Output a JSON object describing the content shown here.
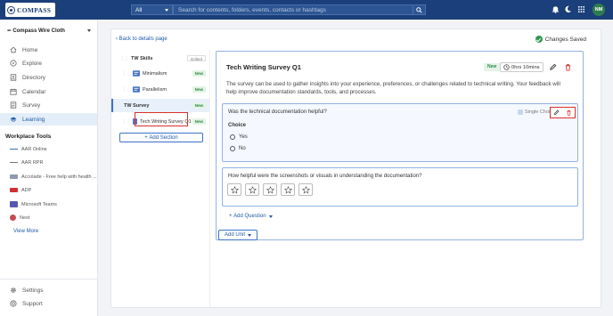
{
  "topbar": {
    "logo_text": "COMPASS",
    "scope_value": "All",
    "search_placeholder": "Search for contents, folders, events, contacts or hashtags",
    "avatar_initials": "NM",
    "bar_color": "#1b3f7a"
  },
  "sidebar": {
    "org_name": "Compass Wire Cloth",
    "nav": [
      {
        "label": "Home",
        "icon": "home-icon"
      },
      {
        "label": "Explore",
        "icon": "compass-icon"
      },
      {
        "label": "Directory",
        "icon": "directory-icon"
      },
      {
        "label": "Calendar",
        "icon": "calendar-icon"
      },
      {
        "label": "Survey",
        "icon": "survey-icon"
      },
      {
        "label": "Learning",
        "icon": "graduation-cap-icon",
        "active": true
      }
    ],
    "tools_heading": "Workplace Tools",
    "tools": [
      {
        "label": "AAR Online",
        "icon": "aar-icon"
      },
      {
        "label": "AAR RPR",
        "icon": "aar-icon"
      },
      {
        "label": "Accolade - Free help with health ...",
        "icon": "accolade-icon"
      },
      {
        "label": "ADP",
        "icon": "adp-icon"
      },
      {
        "label": "Microsoft Teams",
        "icon": "teams-icon"
      },
      {
        "label": "Next",
        "icon": "next-icon"
      }
    ],
    "view_more": "View More",
    "footer": [
      {
        "label": "Settings",
        "icon": "gear-icon"
      },
      {
        "label": "Support",
        "icon": "help-icon"
      }
    ]
  },
  "main": {
    "back_link": "Back to details page",
    "saved_status": "Changes Saved",
    "tree": {
      "items": [
        {
          "label": "TW Skills",
          "badge": "Edited",
          "kind": "section"
        },
        {
          "label": "Minimalism",
          "badge": "New",
          "kind": "unit"
        },
        {
          "label": "Parallelism",
          "badge": "New",
          "kind": "unit"
        },
        {
          "label": "TW Survey",
          "badge": "New",
          "kind": "section"
        },
        {
          "label": "Tech Writing Survey Q1",
          "badge": "New",
          "kind": "survey"
        }
      ],
      "add_section": "Add Section"
    },
    "survey": {
      "title": "Tech Writing Survey Q1",
      "badge": "New",
      "duration": "0hrs 10mins",
      "description": "The survey can be used to gather insights into your experience, preferences, or challenges related to technical writing. Your feedback will help improve documentation standards, tools, and processes.",
      "questions": [
        {
          "text": "Was the technical documentation helpful?",
          "type": "Single Choice",
          "choice_label": "Choice",
          "options": [
            "Yes",
            "No"
          ]
        },
        {
          "text": "How helpful were the screenshots or visuals in understanding the documentation?",
          "rating_max": 5
        }
      ],
      "add_question": "Add Question"
    },
    "add_unit": "Add Unit"
  }
}
